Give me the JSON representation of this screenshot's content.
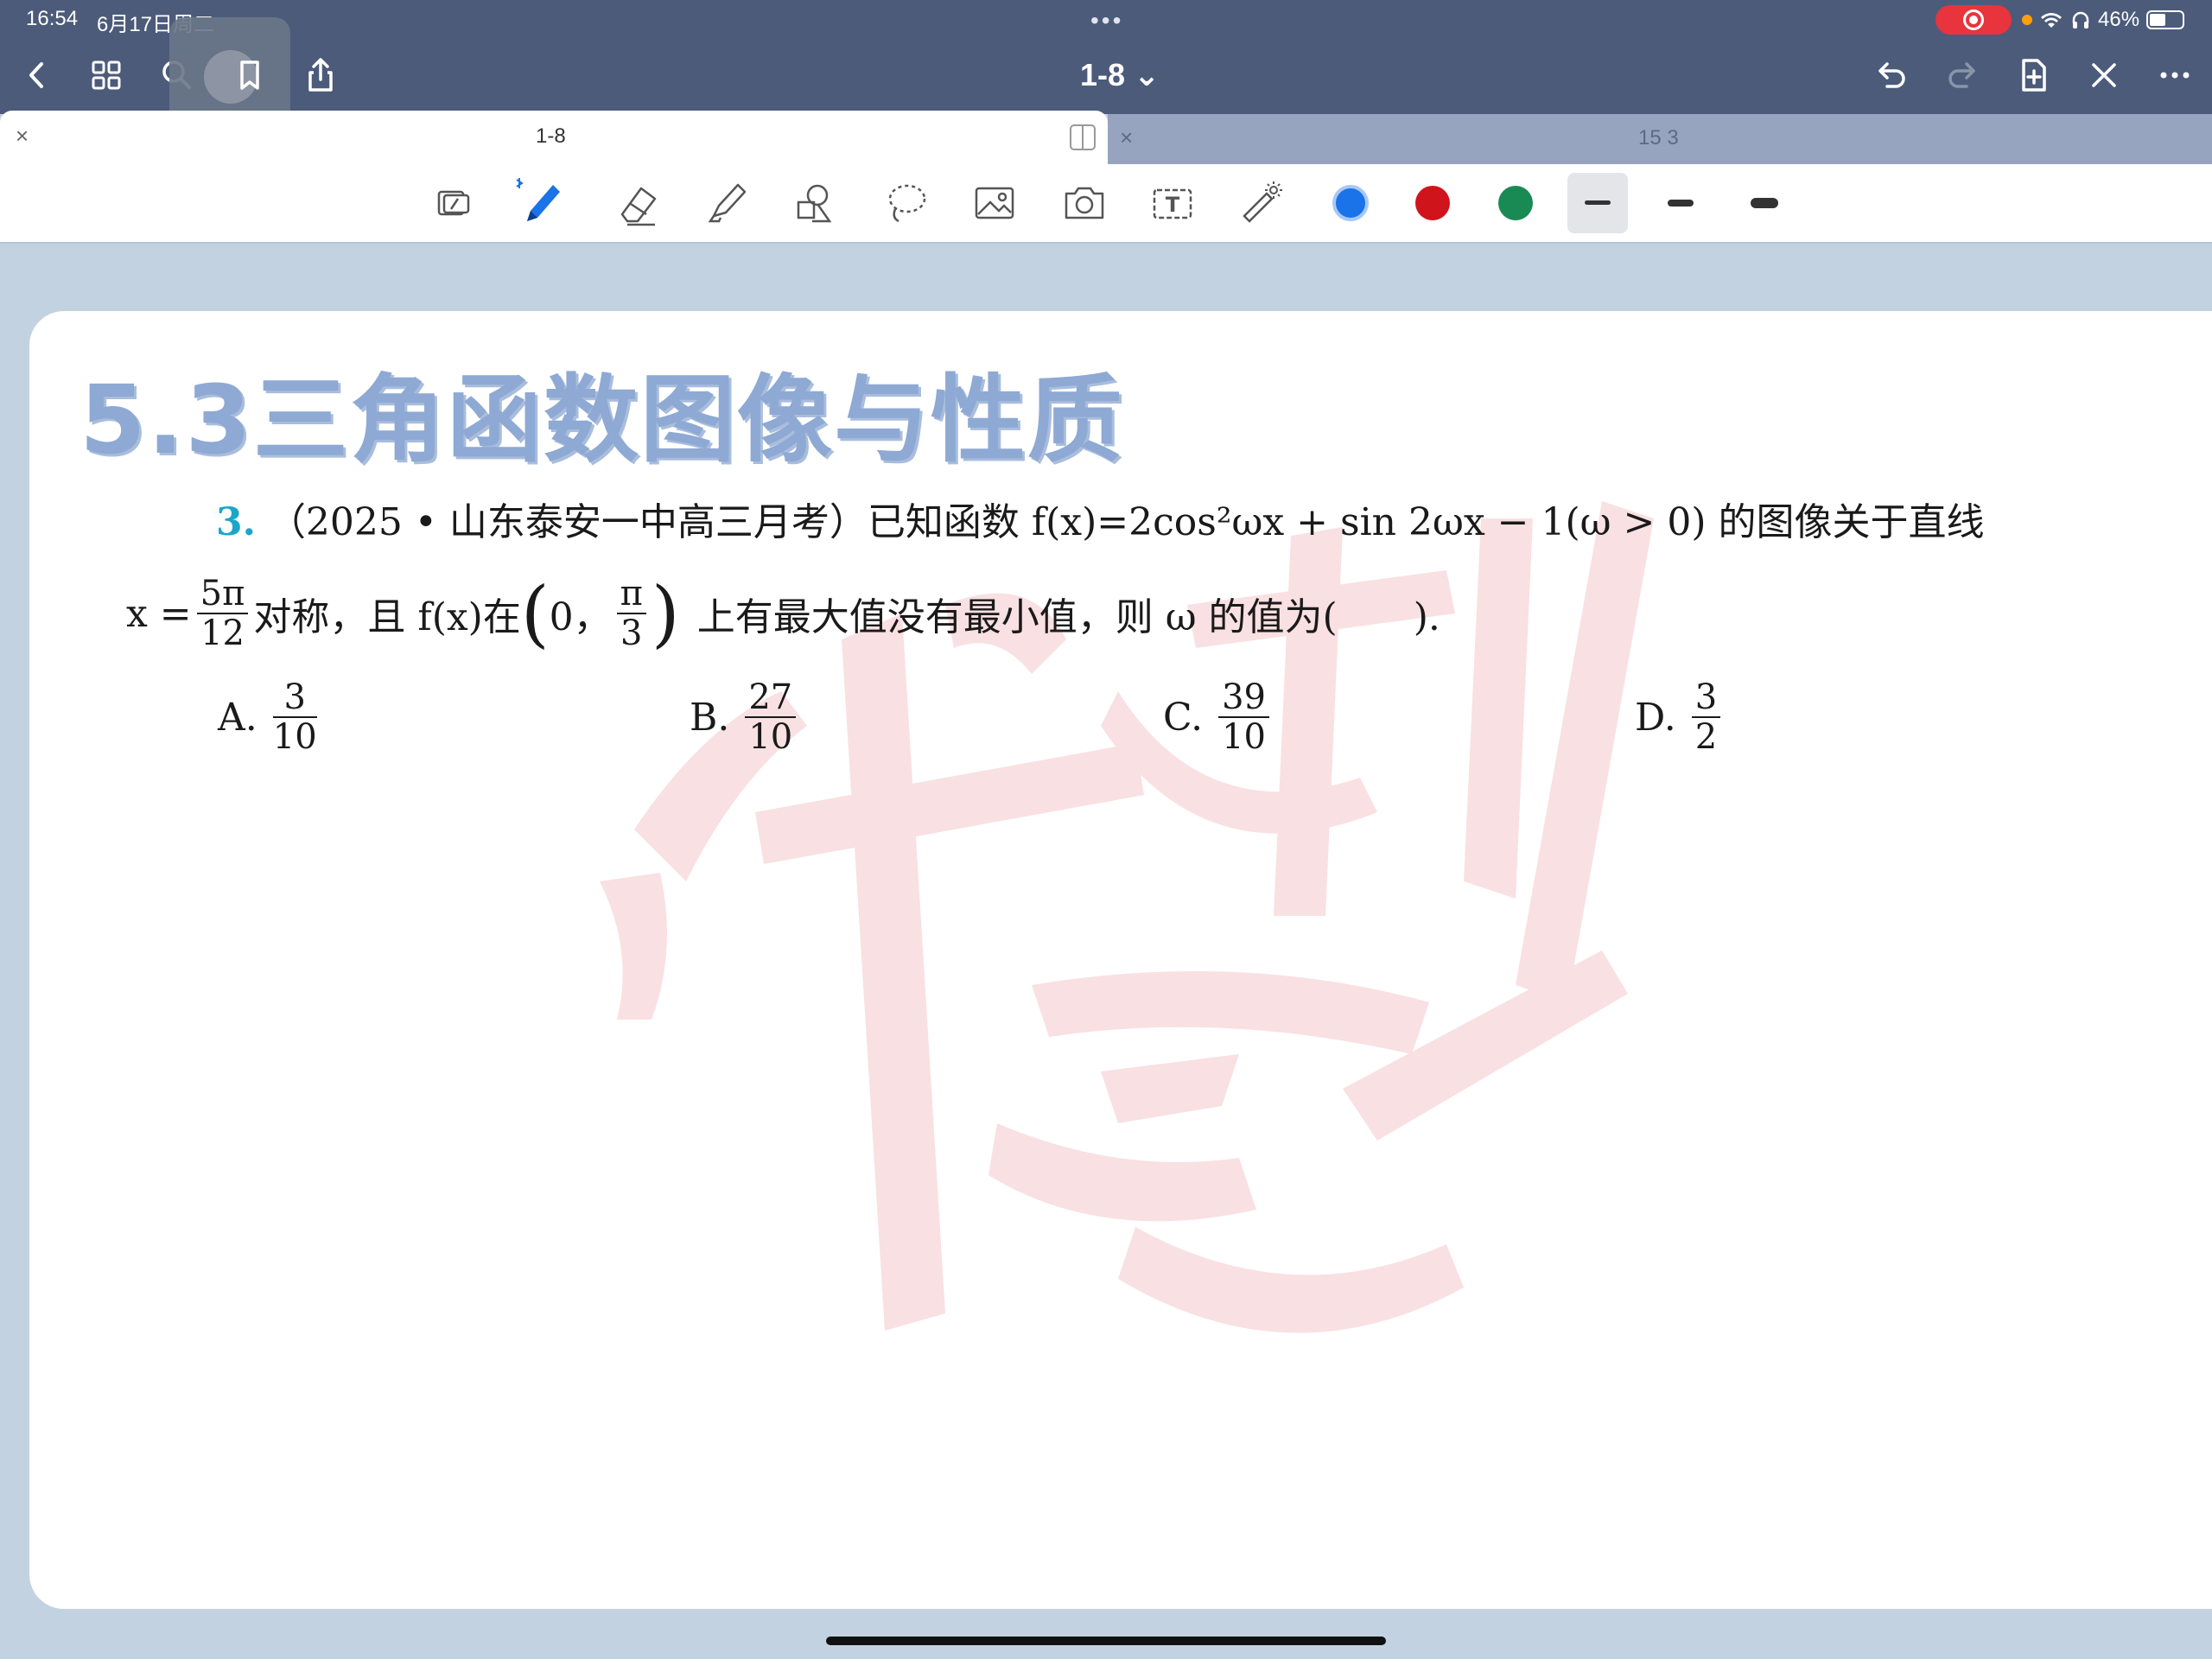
{
  "status_bar": {
    "time": "16:54",
    "date": "6月17日周二",
    "dots": "•••",
    "battery_percent": "46%"
  },
  "nav": {
    "doc_title": "1-8 ⌄"
  },
  "tabs": [
    {
      "label": "1-8",
      "close": "×"
    },
    {
      "label": "15 3",
      "close": "×"
    }
  ],
  "toolbar": {
    "colors": [
      "#1a73e8",
      "#d0141b",
      "#1a8a55"
    ],
    "text_tool_label": "T"
  },
  "page": {
    "heading": "5.3三角函数图像与性质",
    "question_number": "3.",
    "line1": "（2025 • 山东泰安一中高三月考）已知函数 f(x)=2cos²ωx + sin 2ωx − 1(ω > 0) 的图像关于直线",
    "line2_a": "x =",
    "line2_frac_num": "5π",
    "line2_frac_den": "12",
    "line2_b": "对称，且 f(x)在",
    "interval_open": "(",
    "interval_zero": "0，",
    "interval_frac_num": "π",
    "interval_frac_den": "3",
    "interval_close": ")",
    "line2_c": "上有最大值没有最小值，则 ω 的值为(　　).",
    "options": [
      {
        "letter": "A.",
        "num": "3",
        "den": "10"
      },
      {
        "letter": "B.",
        "num": "27",
        "den": "10"
      },
      {
        "letter": "C.",
        "num": "39",
        "den": "10"
      },
      {
        "letter": "D.",
        "num": "3",
        "den": "2"
      }
    ]
  }
}
